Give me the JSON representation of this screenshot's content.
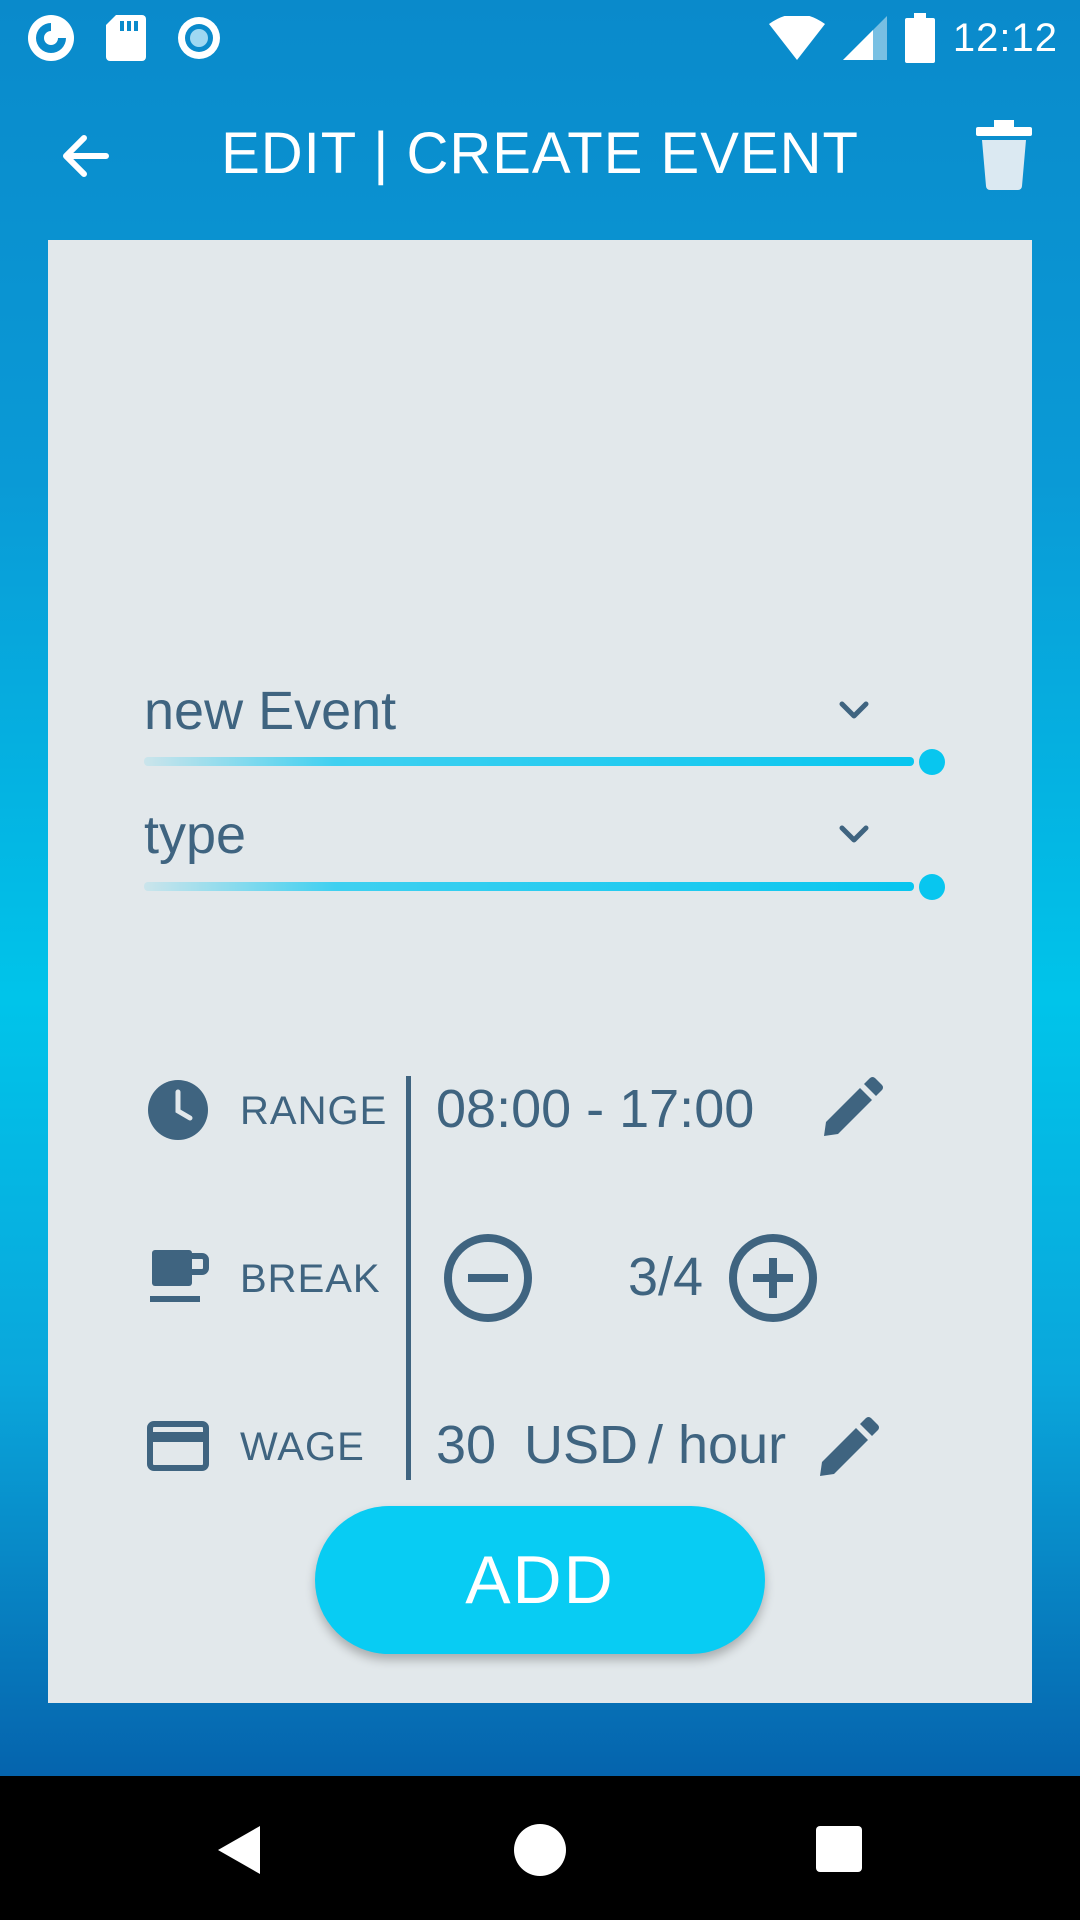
{
  "status_bar": {
    "time": "12:12",
    "icons": [
      "app-notification-icon",
      "sd-card-icon",
      "record-icon",
      "wifi-icon",
      "signal-icon",
      "battery-icon"
    ]
  },
  "app_bar": {
    "title": "EDIT | CREATE EVENT",
    "back_icon": "arrow-back-icon",
    "delete_icon": "trash-icon"
  },
  "form": {
    "event_name": {
      "value": "new Event"
    },
    "event_type": {
      "value": "type"
    },
    "range": {
      "label": "RANGE",
      "value": "08:00 - 17:00"
    },
    "break": {
      "label": "BREAK",
      "value": "3/4"
    },
    "wage": {
      "label": "WAGE",
      "amount": "30",
      "currency": "USD",
      "unit": "/ hour"
    }
  },
  "actions": {
    "add_label": "ADD"
  },
  "colors": {
    "accent": "#08ccf3",
    "text": "#3f6480",
    "card": "#e2e8eb",
    "header": "#0a8acb"
  }
}
